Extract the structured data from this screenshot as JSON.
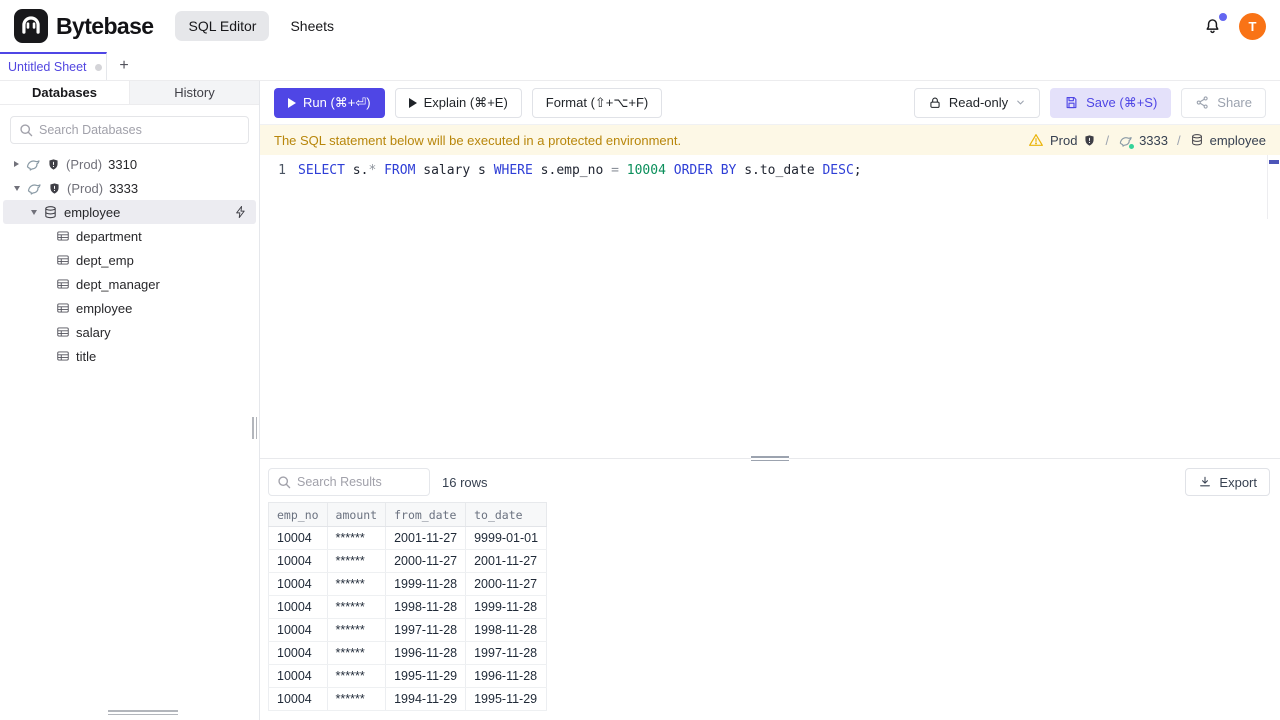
{
  "header": {
    "brand": "Bytebase",
    "nav": [
      {
        "label": "SQL Editor"
      },
      {
        "label": "Sheets"
      }
    ],
    "avatar_text": "T"
  },
  "sheet_tabs": {
    "active_tab": "Untitled Sheet",
    "new_tab_label": "+"
  },
  "sidebar": {
    "tabs": [
      {
        "label": "Databases"
      },
      {
        "label": "History"
      }
    ],
    "search_placeholder": "Search Databases",
    "instances": [
      {
        "env": "(Prod)",
        "name": "3310"
      },
      {
        "env": "(Prod)",
        "name": "3333"
      }
    ],
    "database": "employee",
    "tables": [
      "department",
      "dept_emp",
      "dept_manager",
      "employee",
      "salary",
      "title"
    ]
  },
  "toolbar": {
    "run_label": "Run (⌘+⏎)",
    "explain_label": "Explain (⌘+E)",
    "format_label": "Format (⇧+⌥+F)",
    "readonly_label": "Read-only",
    "save_label": "Save (⌘+S)",
    "share_label": "Share"
  },
  "notice": {
    "message": "The SQL statement below will be executed in a protected environment.",
    "environment": "Prod",
    "instance": "3333",
    "database": "employee"
  },
  "editor": {
    "line_number": "1",
    "code_tokens": [
      {
        "text": "SELECT",
        "type": "kw"
      },
      {
        "text": " s.",
        "type": "id"
      },
      {
        "text": "*",
        "type": "op"
      },
      {
        "text": " ",
        "type": "id"
      },
      {
        "text": "FROM",
        "type": "kw"
      },
      {
        "text": " salary s ",
        "type": "id"
      },
      {
        "text": "WHERE",
        "type": "kw"
      },
      {
        "text": " s.emp_no ",
        "type": "id"
      },
      {
        "text": "=",
        "type": "op"
      },
      {
        "text": " ",
        "type": "id"
      },
      {
        "text": "10004",
        "type": "num"
      },
      {
        "text": " ",
        "type": "id"
      },
      {
        "text": "ORDER BY",
        "type": "kw"
      },
      {
        "text": " s.to_date ",
        "type": "id"
      },
      {
        "text": "DESC",
        "type": "kw"
      },
      {
        "text": ";",
        "type": "id"
      }
    ]
  },
  "results": {
    "search_placeholder": "Search Results",
    "row_count": "16 rows",
    "export_label": "Export",
    "columns": [
      "emp_no",
      "amount",
      "from_date",
      "to_date"
    ],
    "rows": [
      [
        "10004",
        "******",
        "2001-11-27",
        "9999-01-01"
      ],
      [
        "10004",
        "******",
        "2000-11-27",
        "2001-11-27"
      ],
      [
        "10004",
        "******",
        "1999-11-28",
        "2000-11-27"
      ],
      [
        "10004",
        "******",
        "1998-11-28",
        "1999-11-28"
      ],
      [
        "10004",
        "******",
        "1997-11-28",
        "1998-11-28"
      ],
      [
        "10004",
        "******",
        "1996-11-28",
        "1997-11-28"
      ],
      [
        "10004",
        "******",
        "1995-11-29",
        "1996-11-28"
      ],
      [
        "10004",
        "******",
        "1994-11-29",
        "1995-11-29"
      ]
    ]
  },
  "colors": {
    "accent": "#4f46e5",
    "accent_light_bg": "#e4e1fa",
    "avatar_bg": "#f97316",
    "notification_badge": "#6366f1",
    "notice_bg": "#fdf8e6",
    "notice_text": "#b8860b",
    "warning": "#eab308",
    "connection_ok": "#34d399",
    "sql_keyword": "#2e3ed6",
    "sql_number": "#0b8f5b",
    "selected_tree_row_bg": "#ececf1"
  }
}
